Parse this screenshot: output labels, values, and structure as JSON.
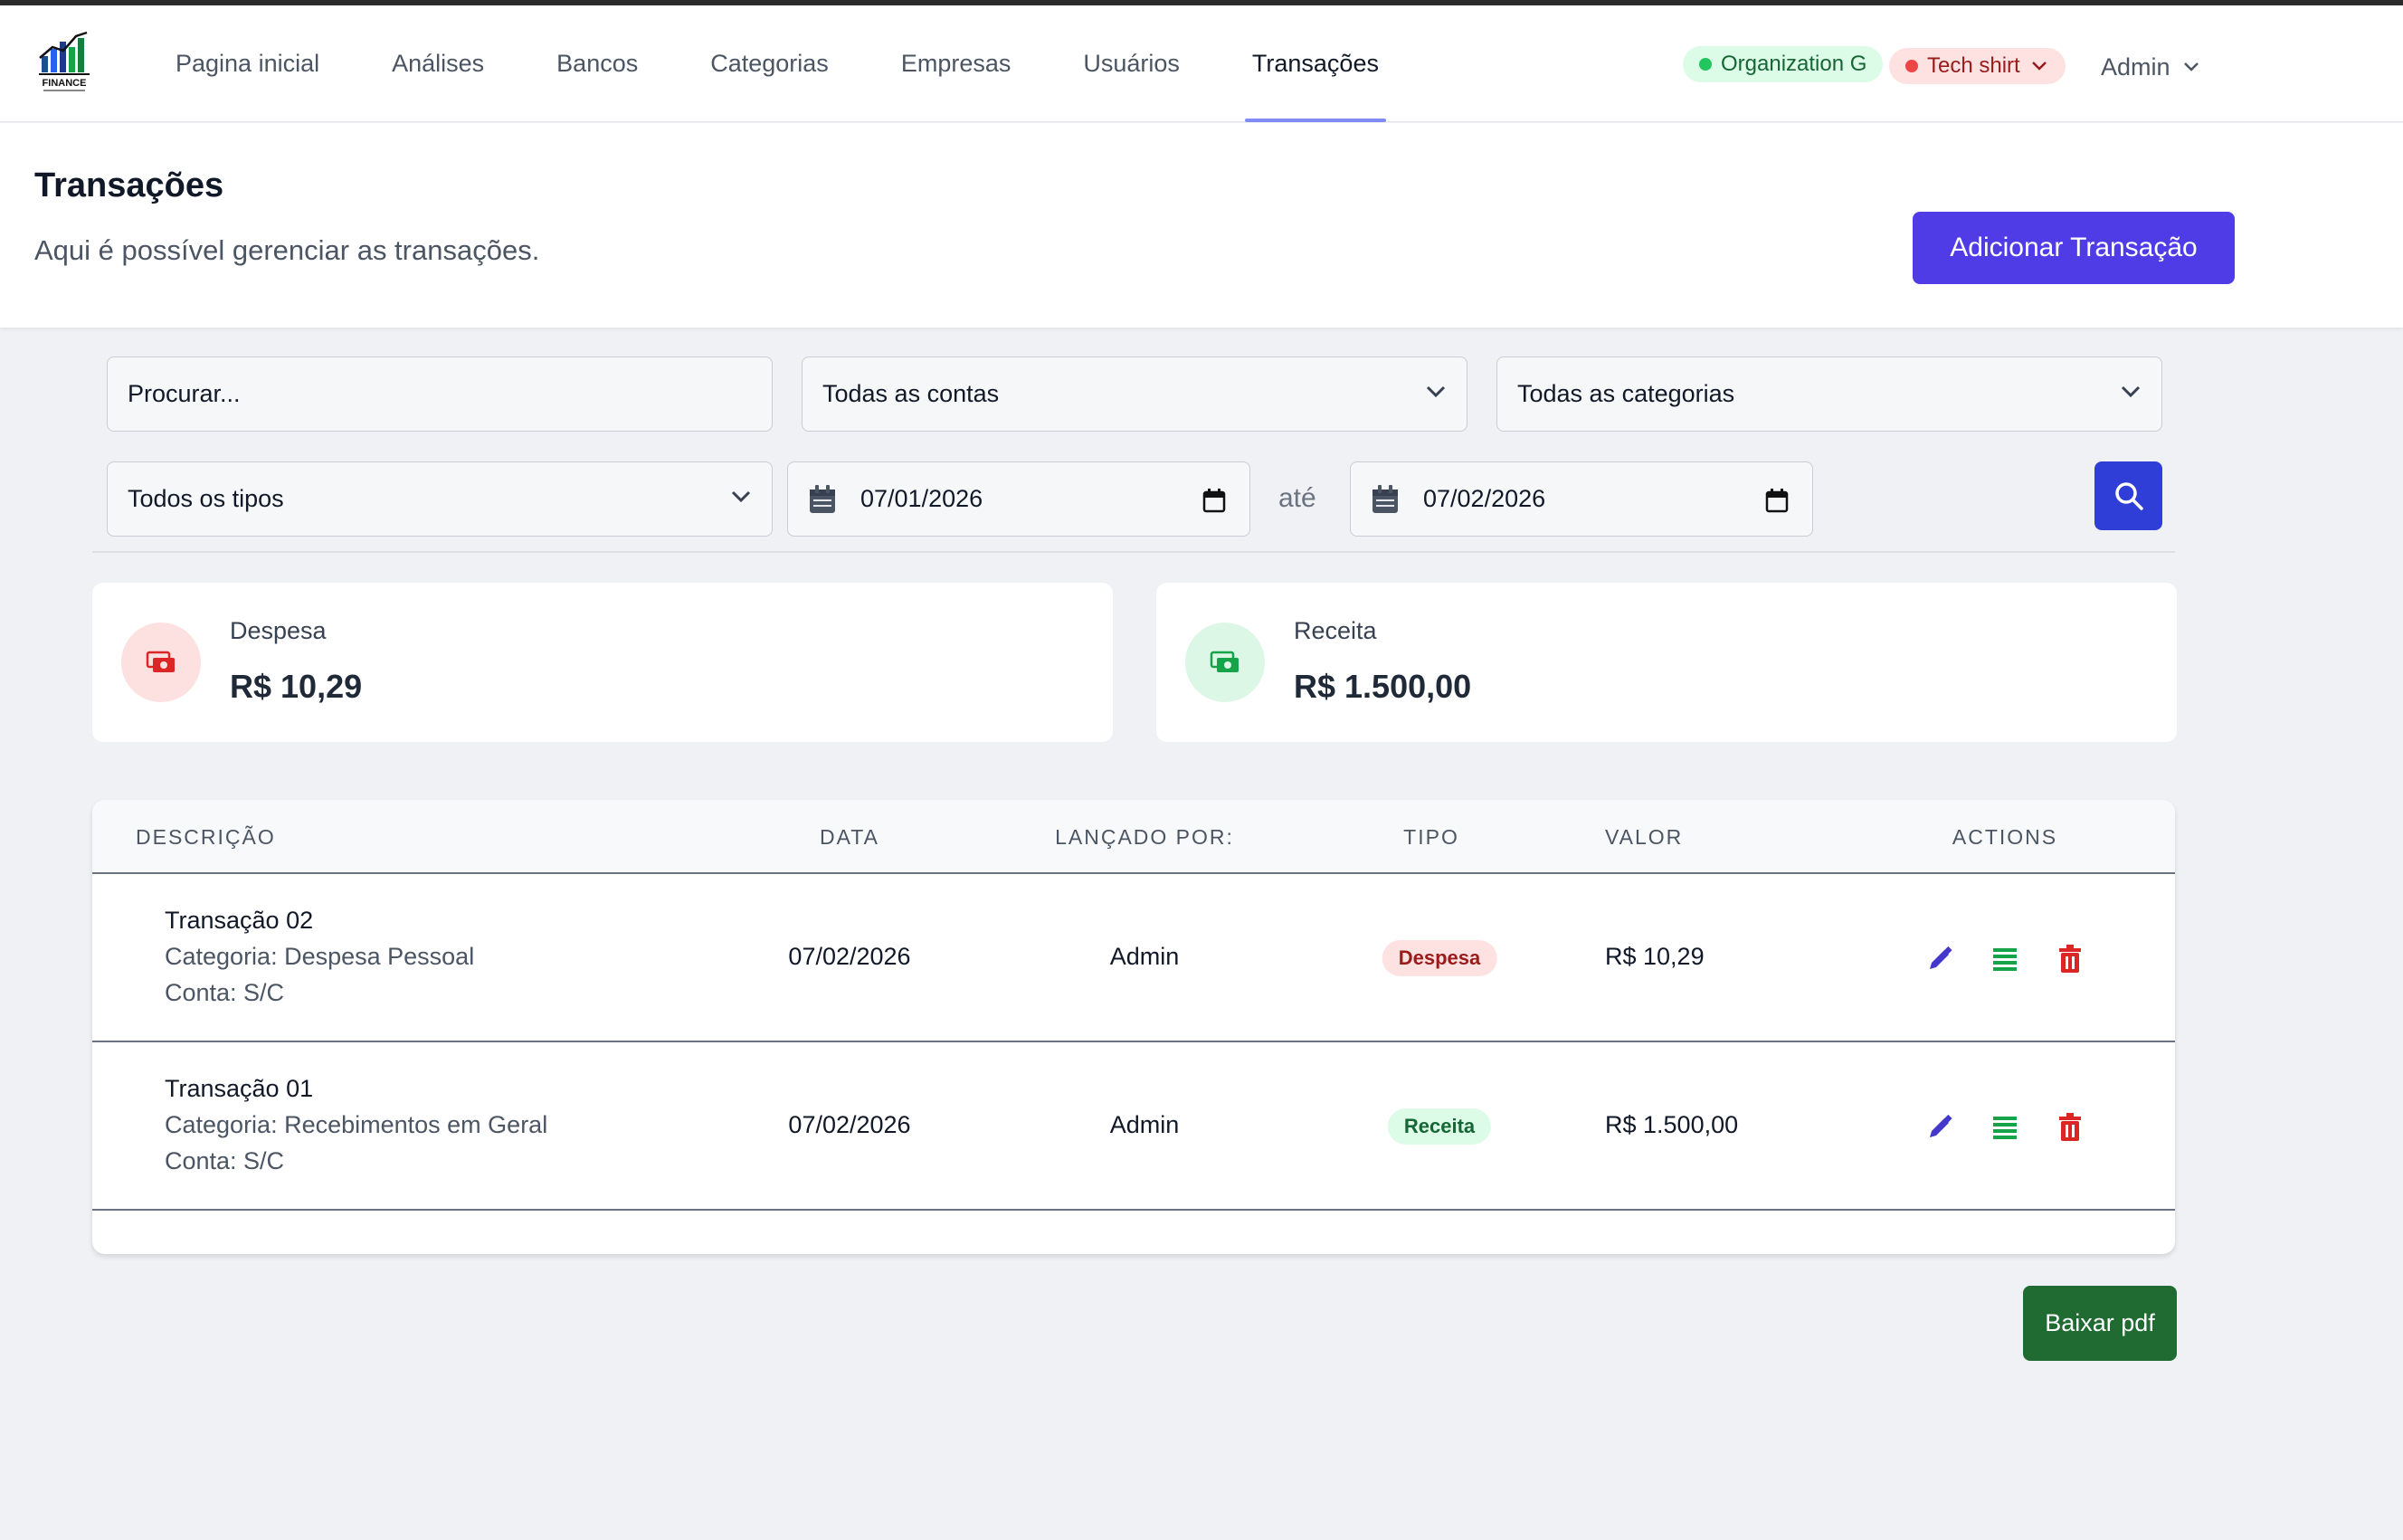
{
  "app": {
    "logo_text": "FINANCE",
    "accent_color": "#4f3ce6"
  },
  "nav": {
    "items": [
      {
        "label": "Pagina inicial",
        "active": false
      },
      {
        "label": "Análises",
        "active": false
      },
      {
        "label": "Bancos",
        "active": false
      },
      {
        "label": "Categorias",
        "active": false
      },
      {
        "label": "Empresas",
        "active": false
      },
      {
        "label": "Usuários",
        "active": false
      },
      {
        "label": "Transações",
        "active": true
      }
    ],
    "organization": "Organization G",
    "company": "Tech shirt",
    "user": "Admin"
  },
  "header": {
    "title": "Transações",
    "subtitle": "Aqui é possível gerenciar as transações.",
    "add_button": "Adicionar Transação"
  },
  "filters": {
    "search_placeholder": "Procurar...",
    "accounts": "Todas as contas",
    "categories": "Todas as categorias",
    "types": "Todos os tipos",
    "date_from": "07/01/2026",
    "date_separator": "até",
    "date_to": "07/02/2026"
  },
  "summary": {
    "expense": {
      "label": "Despesa",
      "amount": "R$ 10,29",
      "color": "#dc2626"
    },
    "income": {
      "label": "Receita",
      "amount": "R$ 1.500,00",
      "color": "#16a34a"
    }
  },
  "table": {
    "headers": {
      "description": "DESCRIÇÃO",
      "date": "DATA",
      "posted_by": "LANÇADO POR:",
      "type": "TIPO",
      "value": "VALOR",
      "actions": "ACTIONS"
    },
    "rows": [
      {
        "title": "Transação 02",
        "category": "Categoria: Despesa Pessoal",
        "account": "Conta: S/C",
        "date": "07/02/2026",
        "posted_by": "Admin",
        "type": "Despesa",
        "value": "R$ 10,29"
      },
      {
        "title": "Transação 01",
        "category": "Categoria: Recebimentos em Geral",
        "account": "Conta: S/C",
        "date": "07/02/2026",
        "posted_by": "Admin",
        "type": "Receita",
        "value": "R$ 1.500,00"
      }
    ]
  },
  "footer": {
    "pdf_button": "Baixar pdf"
  }
}
